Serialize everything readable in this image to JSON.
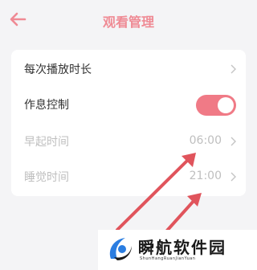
{
  "header": {
    "title": "观看管理"
  },
  "settings": {
    "items": [
      {
        "label": "每次播放时长"
      },
      {
        "label": "作息控制",
        "toggle_on": true
      },
      {
        "label": "早起时间",
        "value": "06:00"
      },
      {
        "label": "睡觉时间",
        "value": "21:00"
      }
    ]
  },
  "colors": {
    "accent": "#ef8a94",
    "toggle": "#f07a86",
    "annotation_arrow": "#e0545c"
  },
  "icons": {
    "back": "back-arrow-icon",
    "chevron": "chevron-right-icon"
  },
  "watermark": {
    "brand": "瞬航软件园",
    "sub": "ShunHangRuanJianYuan"
  }
}
